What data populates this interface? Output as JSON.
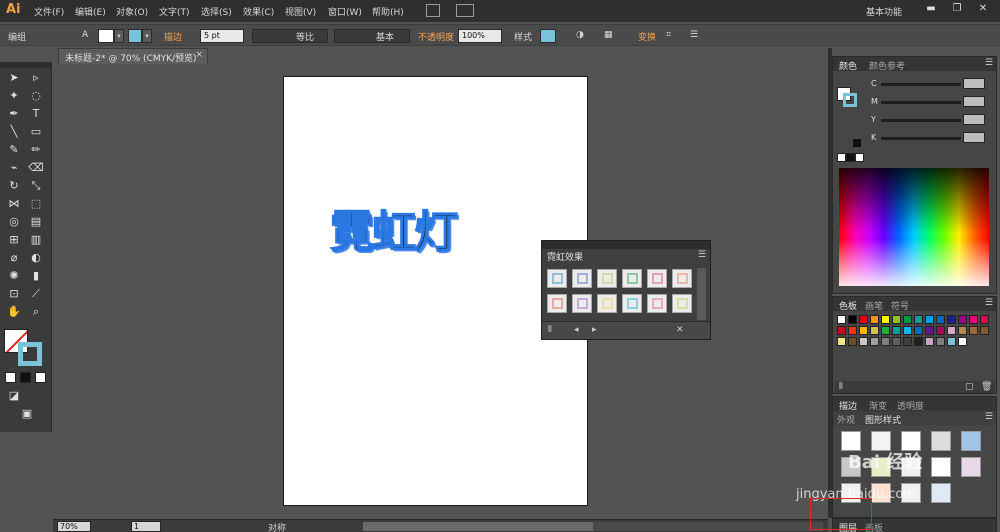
{
  "app": {
    "logo": "Ai",
    "workspace": "基本功能"
  },
  "menu": [
    "文件(F)",
    "编辑(E)",
    "对象(O)",
    "文字(T)",
    "选择(S)",
    "效果(C)",
    "视图(V)",
    "窗口(W)",
    "帮助(H)"
  ],
  "control_bar": {
    "group_label": "编组",
    "stroke_label": "描边",
    "stroke_weight": "5 pt",
    "profile_label": "等比",
    "brush_label": "基本",
    "opacity_label": "不透明度",
    "opacity_value": "100%",
    "style_label": "样式",
    "transform_label": "变换"
  },
  "document_tab": {
    "title": "未标题-2* @ 70% (CMYK/预览)",
    "close": "×"
  },
  "artwork": {
    "text": "霓虹灯",
    "fill": "#111111",
    "stroke": "#2c78e3"
  },
  "neon_panel": {
    "title": "霓虹效果",
    "swatch_colors": [
      "#8fc0d8",
      "#9fb0d8",
      "#d8d8a8",
      "#8fc8a0",
      "#e4a0c0",
      "#e8b8a8",
      "#e8a8a8",
      "#c8a8d8",
      "#e8e0a8",
      "#8ad0e0",
      "#e8a8c8",
      "#d8e0a0"
    ]
  },
  "color_panel": {
    "tabs": [
      "颜色",
      "颜色参考"
    ],
    "channels": [
      "C",
      "M",
      "Y",
      "K"
    ]
  },
  "swatches_panel": {
    "tabs": [
      "色板",
      "画笔",
      "符号"
    ]
  },
  "stroke_panel": {
    "tabs": [
      "描边",
      "渐变",
      "透明度"
    ],
    "sub_tabs": [
      "外观",
      "图形样式"
    ]
  },
  "layers_panel": {
    "tabs": [
      "图层",
      "画板"
    ]
  },
  "status_bar": {
    "zoom": "70%",
    "page": "1",
    "info": "对称"
  },
  "watermark": {
    "brand": "Bai 经验",
    "url": "jingyan.baidu.com"
  }
}
